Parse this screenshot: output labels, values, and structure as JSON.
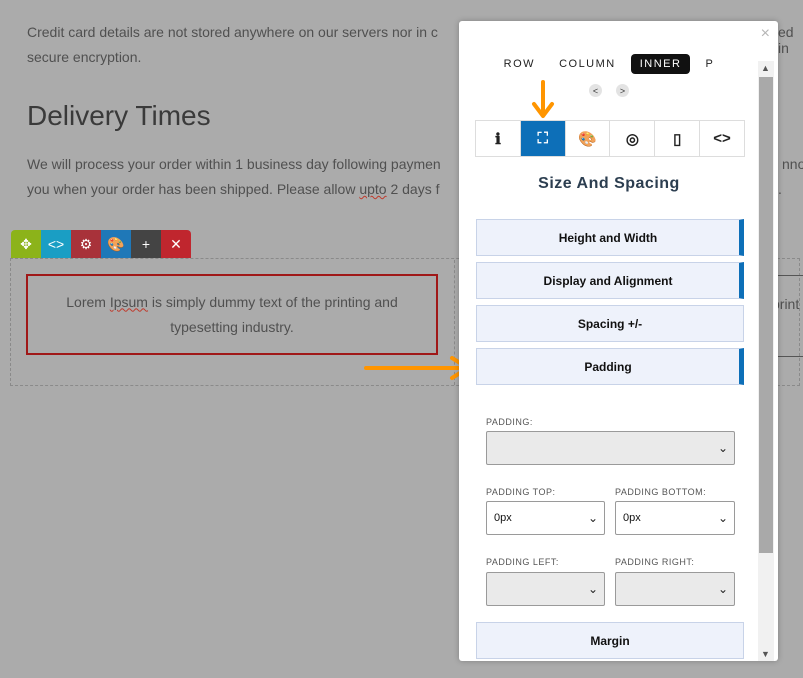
{
  "page": {
    "para1_line1": "Credit card details are not stored anywhere on our servers nor in c",
    "para1_line2": "secure encryption.",
    "para1_right_fragment": "ed in",
    "heading": "Delivery Times",
    "para2_line1": "We will process your order within 1 business day following paymen",
    "para2_line2_a": "you when your order has been shipped. Please allow ",
    "para2_line2_spell": "upto",
    "para2_line2_b": " 2 days f",
    "para2_right_fragment": "nno",
    "para2_right_fragment2": ".",
    "lorem_a": "Lorem ",
    "lorem_spell": "Ipsum",
    "lorem_b": " is simply dummy text of the printing and typesetting industry.",
    "lorem_right_fragment": "print"
  },
  "toolbar": {
    "buttons": [
      {
        "name": "move-icon",
        "glyph": "✥",
        "color": "#8cb31a"
      },
      {
        "name": "code-icon",
        "glyph": "<>",
        "color": "#1a9ec4"
      },
      {
        "name": "gear-icon",
        "glyph": "⚙",
        "color": "#a8323a"
      },
      {
        "name": "palette-icon",
        "glyph": "🎨",
        "color": "#1f78b8"
      },
      {
        "name": "plus-icon",
        "glyph": "+",
        "color": "#444444"
      },
      {
        "name": "close-icon",
        "glyph": "✕",
        "color": "#c0262e"
      }
    ]
  },
  "panel": {
    "close": "×",
    "crumbs": [
      "ROW",
      "COLUMN",
      "INNER",
      "P"
    ],
    "active_crumb": "INNER",
    "nav_prev": "<",
    "nav_next": ">",
    "tabs": [
      {
        "name": "info-icon",
        "glyph": "ℹ"
      },
      {
        "name": "spacing-icon",
        "glyph": "⛶"
      },
      {
        "name": "palette-icon",
        "glyph": "🎨"
      },
      {
        "name": "aperture-icon",
        "glyph": "◎"
      },
      {
        "name": "mobile-icon",
        "glyph": "▯"
      },
      {
        "name": "code-icon",
        "glyph": "<>"
      }
    ],
    "active_tab": 1,
    "title": "Size And Spacing",
    "accordions": {
      "height_width": "Height and Width",
      "display_alignment": "Display and Alignment",
      "spacing": "Spacing +/-",
      "padding": "Padding",
      "margin": "Margin"
    },
    "fields": {
      "padding_label": "PADDING:",
      "padding_value": "",
      "padding_top_label": "PADDING TOP:",
      "padding_top_value": "0px",
      "padding_bottom_label": "PADDING BOTTOM:",
      "padding_bottom_value": "0px",
      "padding_left_label": "PADDING LEFT:",
      "padding_left_value": "",
      "padding_right_label": "PADDING RIGHT:",
      "padding_right_value": ""
    }
  },
  "colors": {
    "accent": "#0d6fb8",
    "highlight_arrow": "#ff9500",
    "overlay": "#ababab"
  }
}
